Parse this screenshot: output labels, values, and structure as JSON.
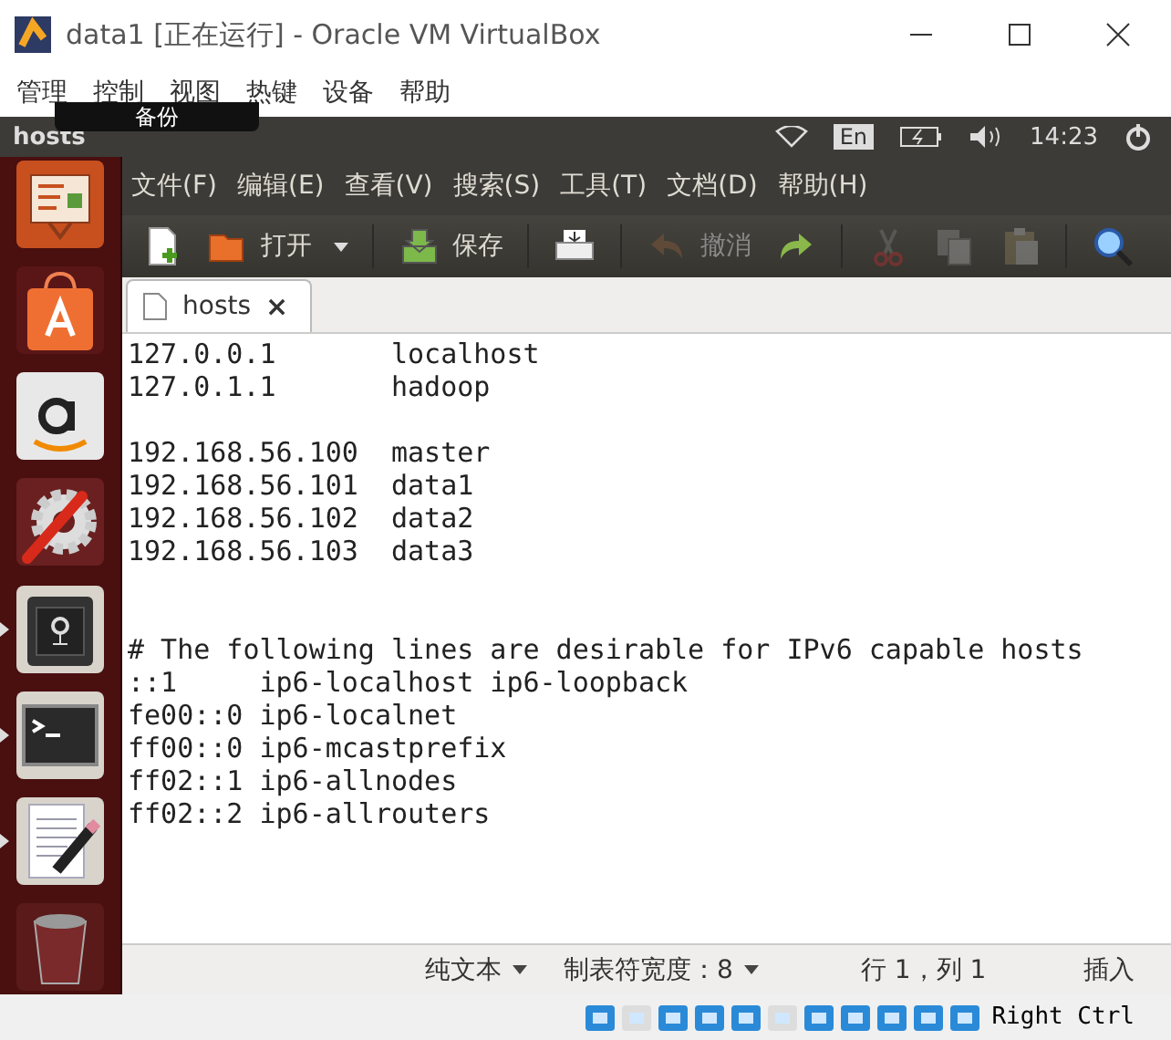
{
  "window": {
    "title": "data1 [正在运行] - Oracle VM VirtualBox"
  },
  "menu": [
    "管理",
    "控制",
    "视图",
    "热键",
    "设备",
    "帮助"
  ],
  "panel": {
    "title": "hosts",
    "tooltip": "备份",
    "language": "En",
    "clock": "14:23"
  },
  "launcher": [
    {
      "kind": "presentation",
      "selected": false
    },
    {
      "kind": "store",
      "selected": false
    },
    {
      "kind": "amazon",
      "selected": false
    },
    {
      "kind": "settings",
      "selected": false
    },
    {
      "kind": "safe",
      "selected": true
    },
    {
      "kind": "terminal",
      "selected": true
    },
    {
      "kind": "editor",
      "selected": true
    },
    {
      "kind": "trash",
      "selected": false
    }
  ],
  "gedit_menu": [
    "文件(F)",
    "编辑(E)",
    "查看(V)",
    "搜索(S)",
    "工具(T)",
    "文档(D)",
    "帮助(H)"
  ],
  "toolbar": [
    {
      "kind": "new"
    },
    {
      "kind": "open",
      "label": "打开"
    },
    {
      "kind": "dropdown"
    },
    {
      "kind": "sep"
    },
    {
      "kind": "save",
      "label": "保存"
    },
    {
      "kind": "sep"
    },
    {
      "kind": "print"
    },
    {
      "kind": "sep"
    },
    {
      "kind": "undo",
      "label": "撤消",
      "disabled": true
    },
    {
      "kind": "redo",
      "disabled": false
    },
    {
      "kind": "sep"
    },
    {
      "kind": "cut",
      "disabled": true
    },
    {
      "kind": "copy",
      "disabled": true
    },
    {
      "kind": "paste",
      "disabled": true
    },
    {
      "kind": "sep"
    },
    {
      "kind": "find"
    }
  ],
  "tab": {
    "label": "hosts",
    "close": "×",
    "selected": true
  },
  "lines": [
    {
      "kind": "text",
      "text": "127.0.0.1       localhost"
    },
    {
      "kind": "text",
      "text": "127.0.1.1       hadoop"
    },
    {
      "kind": "blank"
    },
    {
      "kind": "text",
      "text": "192.168.56.100  master"
    },
    {
      "kind": "text",
      "text": "192.168.56.101  data1"
    },
    {
      "kind": "text",
      "text": "192.168.56.102  data2"
    },
    {
      "kind": "text",
      "text": "192.168.56.103  data3"
    },
    {
      "kind": "blank"
    },
    {
      "kind": "blank"
    },
    {
      "kind": "text",
      "text": "# The following lines are desirable for IPv6 capable hosts"
    },
    {
      "kind": "text",
      "text": "::1     ip6-localhost ip6-loopback"
    },
    {
      "kind": "text",
      "text": "fe00::0 ip6-localnet"
    },
    {
      "kind": "text",
      "text": "ff00::0 ip6-mcastprefix"
    },
    {
      "kind": "text",
      "text": "ff02::1 ip6-allnodes"
    },
    {
      "kind": "text",
      "text": "ff02::2 ip6-allrouters"
    }
  ],
  "status": {
    "language": "纯文本",
    "tab_width": "制表符宽度：8",
    "position": "行 1，列 1",
    "mode": "插入"
  },
  "vbox_status": {
    "host_key": "Right Ctrl"
  }
}
